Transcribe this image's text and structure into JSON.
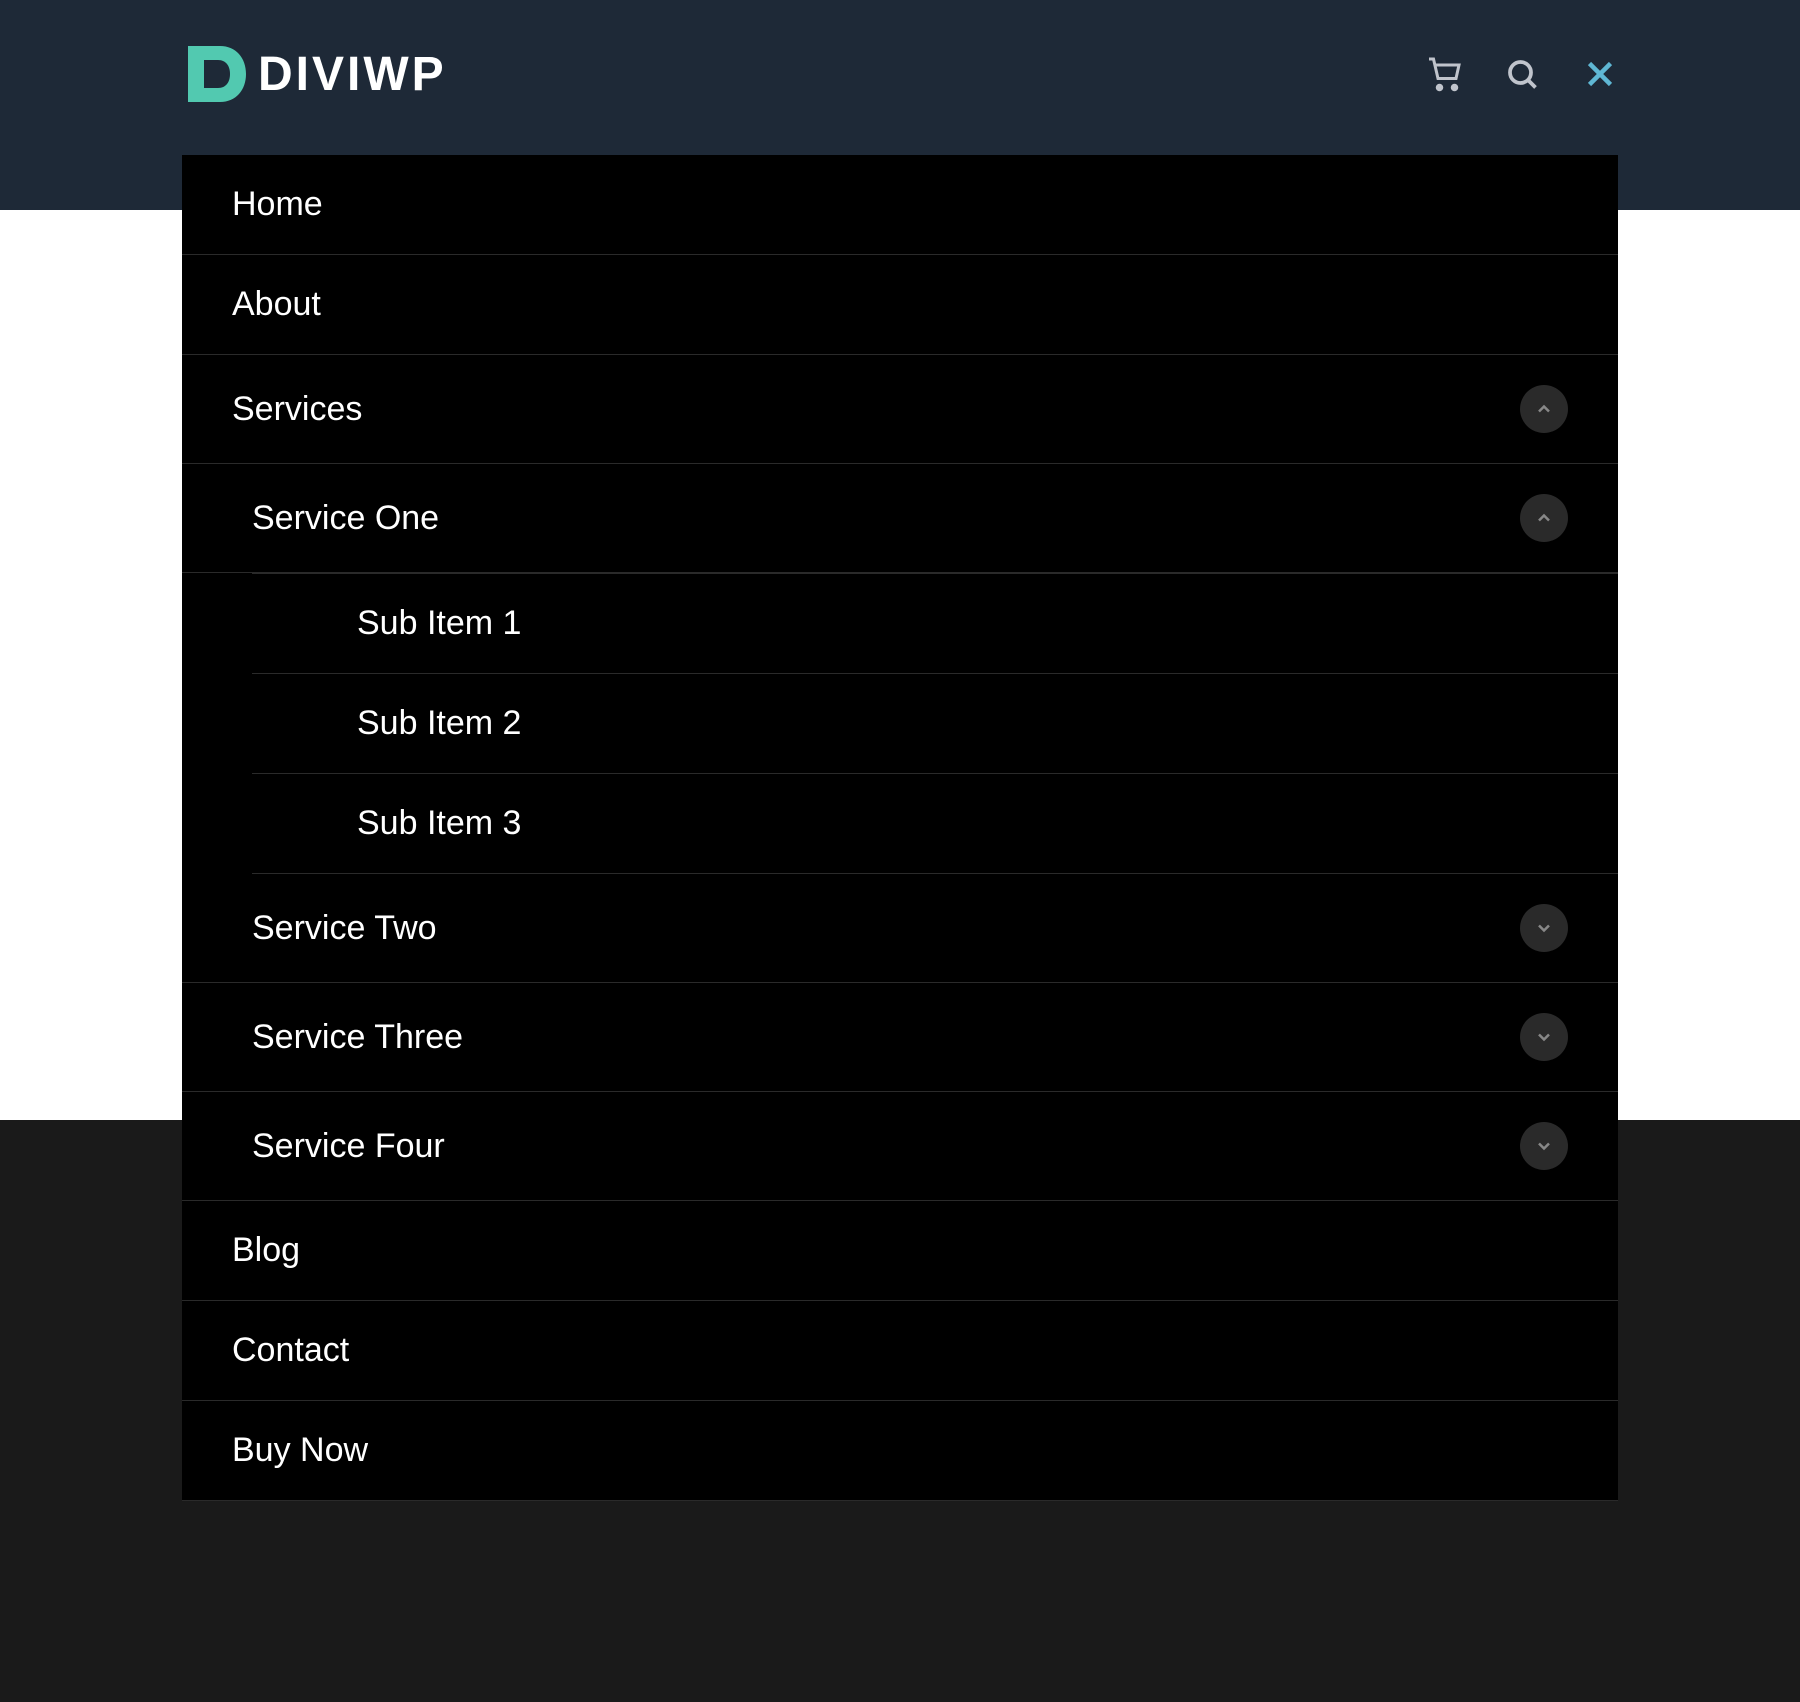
{
  "brand": {
    "name": "DIVIWP"
  },
  "menu": {
    "items": [
      {
        "label": "Home",
        "id": "home"
      },
      {
        "label": "About",
        "id": "about"
      },
      {
        "label": "Services",
        "id": "services",
        "expanded": true,
        "hasChildren": true
      },
      {
        "label": "Blog",
        "id": "blog"
      },
      {
        "label": "Contact",
        "id": "contact"
      },
      {
        "label": "Buy Now",
        "id": "buy-now"
      }
    ],
    "services": {
      "items": [
        {
          "label": "Service One",
          "id": "service-one",
          "expanded": true,
          "hasChildren": true
        },
        {
          "label": "Service Two",
          "id": "service-two",
          "expanded": false,
          "hasChildren": true
        },
        {
          "label": "Service Three",
          "id": "service-three",
          "expanded": false,
          "hasChildren": true
        },
        {
          "label": "Service Four",
          "id": "service-four",
          "expanded": false,
          "hasChildren": true
        }
      ]
    },
    "serviceOne": {
      "items": [
        {
          "label": "Sub Item 1",
          "id": "sub-item-1"
        },
        {
          "label": "Sub Item 2",
          "id": "sub-item-2"
        },
        {
          "label": "Sub Item 3",
          "id": "sub-item-3"
        }
      ]
    }
  }
}
